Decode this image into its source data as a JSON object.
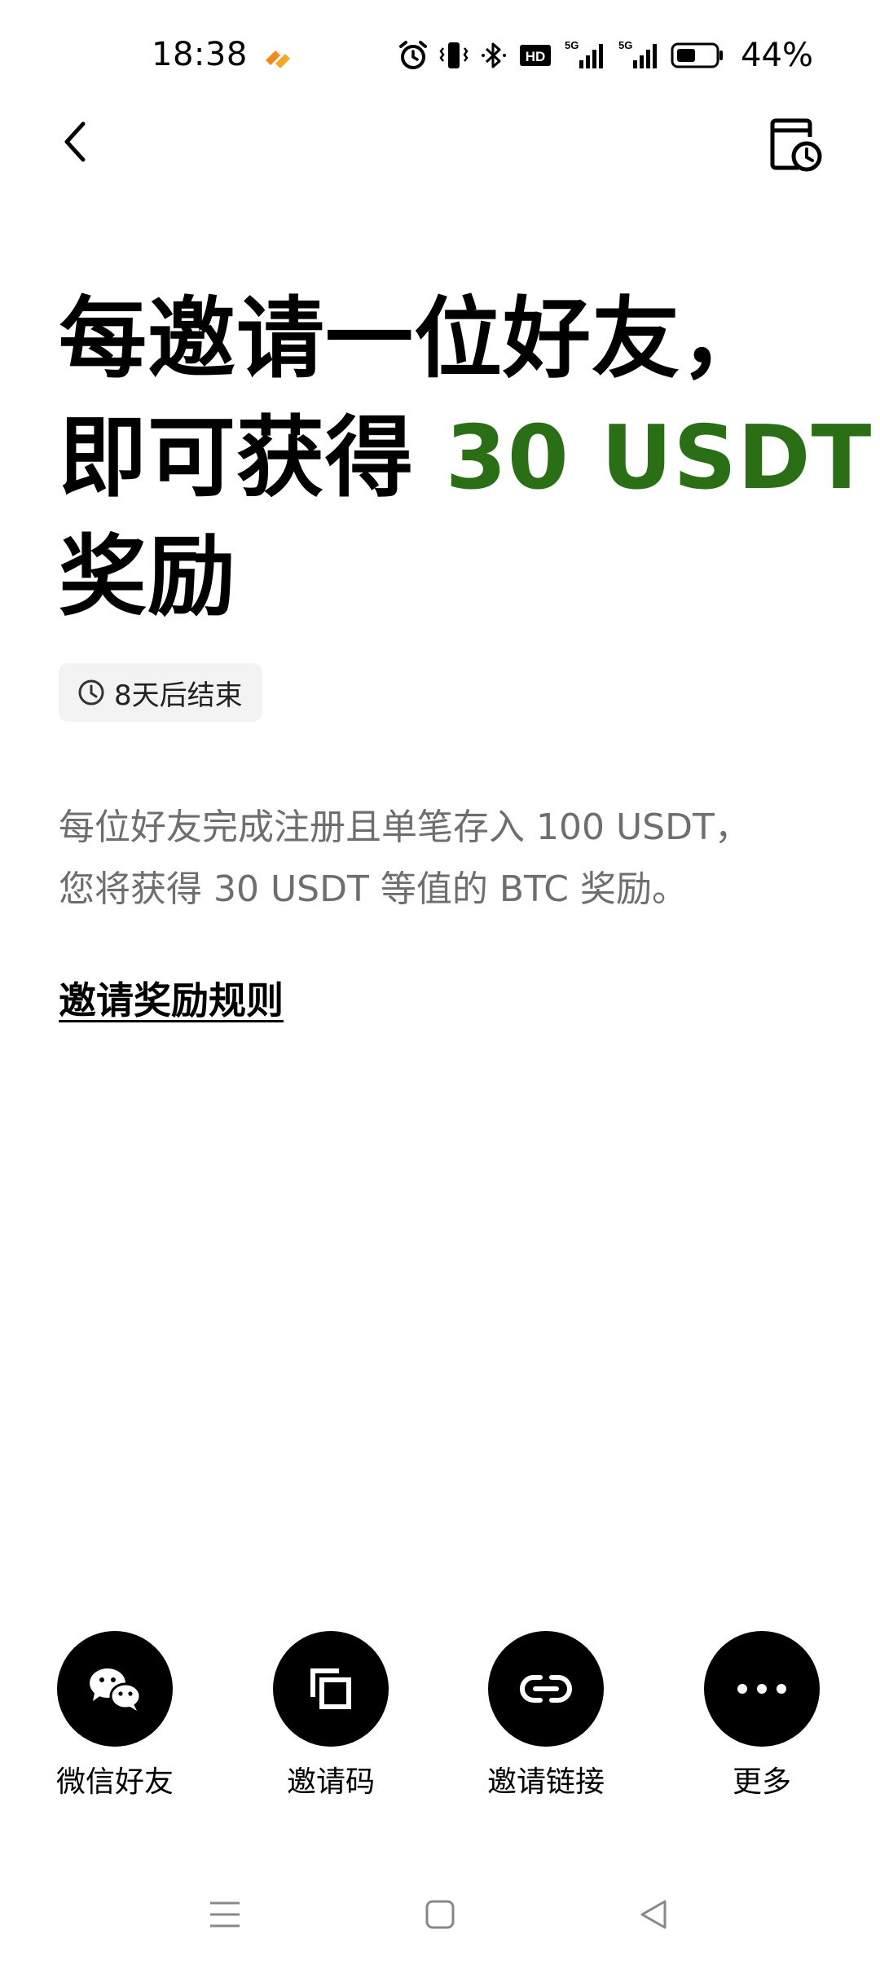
{
  "status_bar": {
    "time": "18:38",
    "battery_percent": "44%",
    "network_label_1": "5G",
    "network_label_2": "5G",
    "hd_label": "HD"
  },
  "nav": {
    "back_icon": "chevron-left-icon",
    "history_icon": "calendar-clock-icon"
  },
  "headline": {
    "line1": "每邀请一位好友，",
    "line2_prefix": "即可获得 ",
    "line2_accent": "30 USDT",
    "line3": "奖励",
    "accent_color": "#2a6e16"
  },
  "countdown": {
    "text": "8天后结束",
    "icon": "clock-icon"
  },
  "description": {
    "line1": "每位好友完成注册且单笔存入 100 USDT，",
    "line2": "您将获得 30 USDT 等值的 BTC 奖励。"
  },
  "rules_link": "邀请奖励规则",
  "share": {
    "items": [
      {
        "label": "微信好友",
        "icon": "wechat-icon"
      },
      {
        "label": "邀请码",
        "icon": "copy-icon"
      },
      {
        "label": "邀请链接",
        "icon": "link-icon"
      },
      {
        "label": "更多",
        "icon": "more-dots-icon"
      }
    ]
  }
}
